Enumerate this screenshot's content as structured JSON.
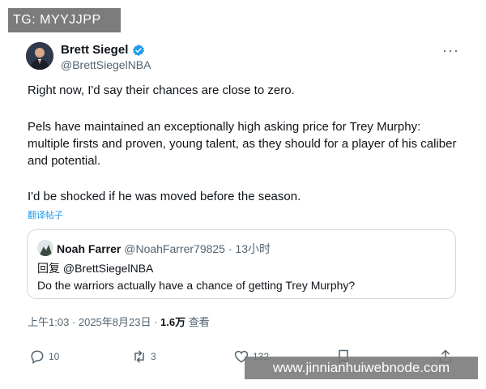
{
  "overlay_top": {
    "text": "TG: MYYJJPP"
  },
  "tweet": {
    "author_name": "Brett Siegel",
    "author_handle": "@BrettSiegelNBA",
    "verified_color": "#1d9bf0",
    "more_icon": "···",
    "paragraphs": [
      "Right now, I'd say their chances are close to zero.",
      "Pels have maintained an exceptionally high asking price for Trey Murphy: multiple firsts and proven, young talent, as they should for a player of his caliber and potential.",
      "I'd be shocked if he was moved before the season."
    ],
    "translate_label": "翻译帖子",
    "timestamp": "上午1:03 · 2025年8月23日 · ",
    "views_count": "1.6万",
    "views_label": " 查看"
  },
  "quote": {
    "name": "Noah Farrer",
    "handle_time": "@NoahFarrer79825 · 13小时",
    "reply_to": "回复 @BrettSiegelNBA",
    "text": "Do the warriors actually have a chance of getting Trey Murphy?"
  },
  "actions": {
    "reply_count": "10",
    "retweet_count": "3",
    "like_count": "132"
  },
  "overlay_bottom": {
    "text": "www.jinnianhuiwebnode.com"
  }
}
